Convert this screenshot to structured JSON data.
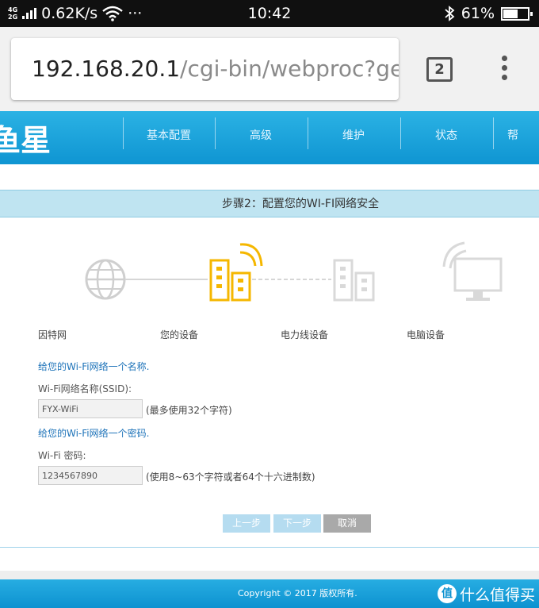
{
  "status_bar": {
    "network_top": "4G",
    "network_bottom": "2G",
    "speed": "0.62K/s",
    "more": "···",
    "time": "10:42",
    "battery": "61%",
    "battery_level": 0.61
  },
  "browser": {
    "url_host": "192.168.20.1",
    "url_path": "/cgi-bin/webproc?getp",
    "tab_count": "2"
  },
  "router": {
    "brand": "鱼星",
    "nav": [
      "基本配置",
      "高级",
      "维护",
      "状态",
      "帮"
    ],
    "step_title": "步骤2：配置您的WI-FI网络安全",
    "devices": [
      "因特网",
      "您的设备",
      "电力线设备",
      "电脑设备"
    ],
    "form": {
      "ssid_prompt": "给您的Wi-Fi网络一个名称.",
      "ssid_label": "Wi-Fi网络名称(SSID):",
      "ssid_value": "FYX-WiFi",
      "ssid_hint": "(最多使用32个字符)",
      "pwd_prompt": "给您的Wi-Fi网络一个密码.",
      "pwd_label": "Wi-Fi 密码:",
      "pwd_value": "1234567890",
      "pwd_hint": "(使用8~63个字符或者64个十六进制数)"
    },
    "buttons": {
      "prev": "上一步",
      "next": "下一步",
      "cancel": "取消"
    },
    "footer": "Copyright © 2017 版权所有."
  },
  "watermark": {
    "logo": "值",
    "text": "什么值得买"
  },
  "colors": {
    "accent_blue": "#0f95d2",
    "active_device": "#f5b700",
    "inactive_device": "#d9d9d9"
  }
}
